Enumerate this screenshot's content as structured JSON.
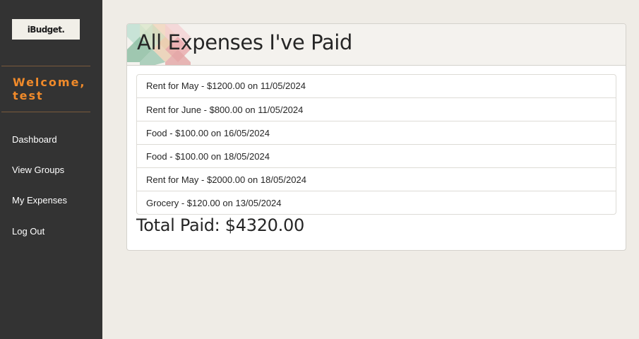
{
  "sidebar": {
    "logo_text": "iBudget.",
    "welcome": "Welcome, test",
    "nav": [
      {
        "label": "Dashboard"
      },
      {
        "label": "View Groups"
      },
      {
        "label": "My Expenses"
      },
      {
        "label": "Log Out"
      }
    ]
  },
  "main": {
    "title": "All Expenses I've Paid",
    "expenses": [
      "Rent for May - $1200.00 on 11/05/2024",
      "Rent for June - $800.00 on 11/05/2024",
      "Food - $100.00 on 16/05/2024",
      "Food - $100.00 on 18/05/2024",
      "Rent for May - $2000.00 on 18/05/2024",
      "Grocery - $120.00 on 13/05/2024"
    ],
    "total": "Total Paid: $4320.00"
  },
  "colors": {
    "sidebar_bg": "#333333",
    "accent": "#f08a2a",
    "page_bg": "#efece6"
  }
}
